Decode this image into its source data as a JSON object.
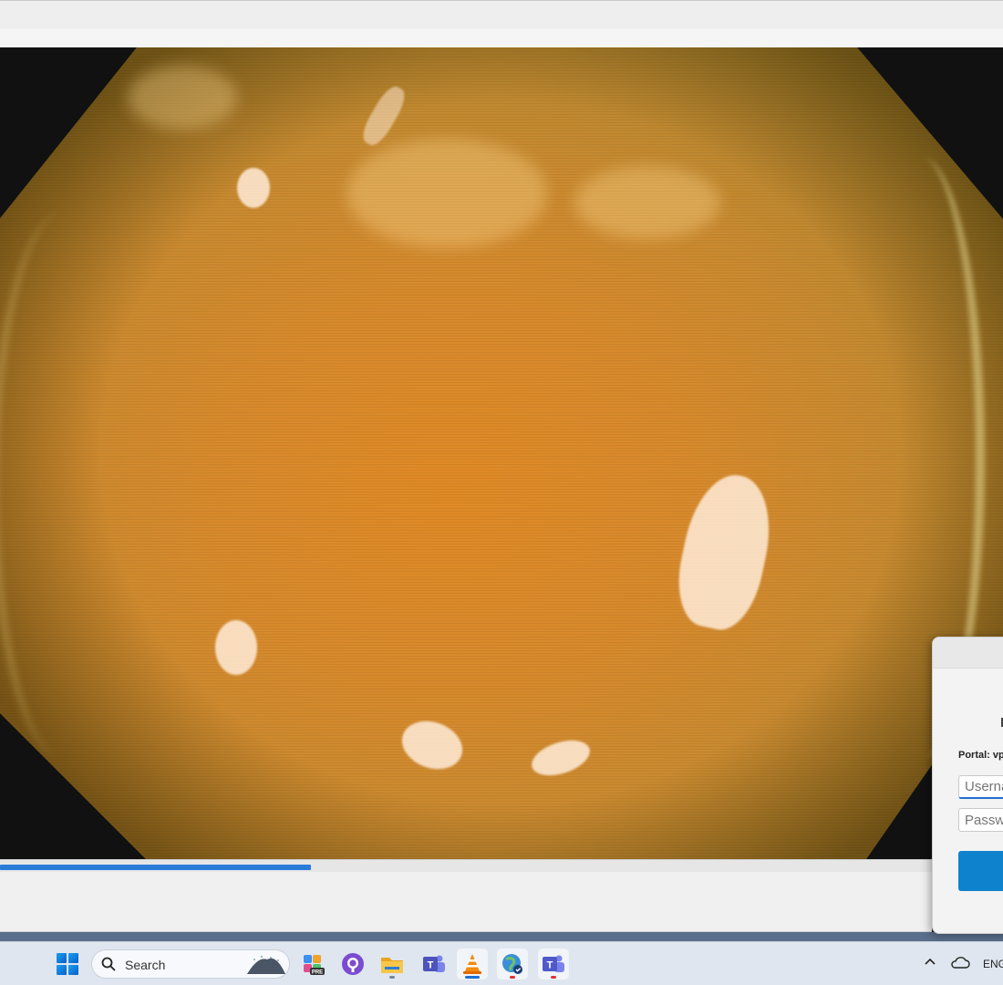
{
  "player": {
    "progress_fraction": 0.334
  },
  "login_dialog": {
    "portal_label": "Portal: vp",
    "username_placeholder": "Userna",
    "password_placeholder": "Passwo"
  },
  "taskbar": {
    "search_label": "Search",
    "apps": [
      {
        "name": "copilot-icon",
        "label": "PRE"
      },
      {
        "name": "github-icon"
      },
      {
        "name": "file-explorer-icon"
      },
      {
        "name": "teams-icon",
        "label": "T"
      },
      {
        "name": "vlc-icon"
      },
      {
        "name": "globe-vpn-icon"
      },
      {
        "name": "teams-red-icon",
        "label": "T"
      }
    ],
    "tray_language": "ENG"
  },
  "colors": {
    "accent": "#2b7bd9",
    "button": "#0e82cc",
    "taskbar": "#dfe6ef"
  }
}
